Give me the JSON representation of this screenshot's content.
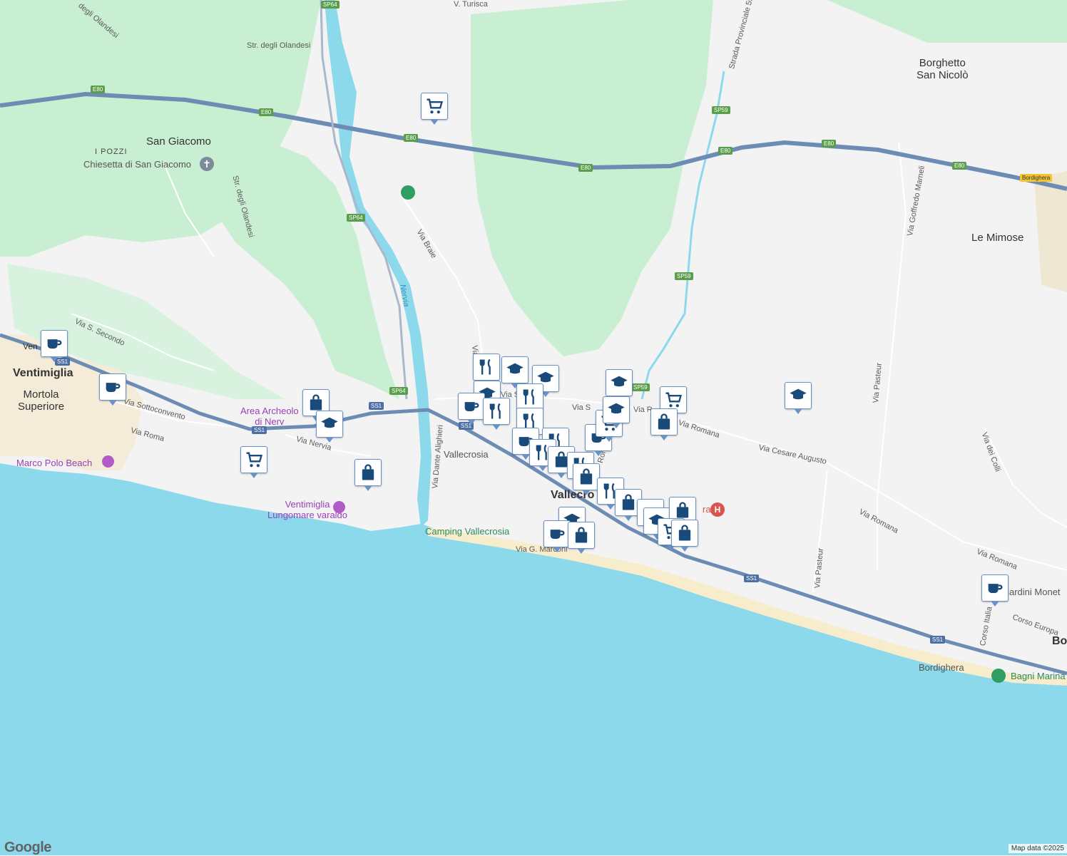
{
  "map": {
    "places": {
      "ventimiglia": "Ventimiglia",
      "mortola": "Mortola\nSuperiore",
      "san_giacomo": "San Giacomo",
      "i_pozzi": "I POZZI",
      "borghetto": "Borghetto\nSan Nicolò",
      "le_mimose": "Le Mimose",
      "vallecrosia": "Vallecro",
      "bordighera_cut": "Bor",
      "venti_cut": "Ven"
    },
    "pois": {
      "chiesetta": "Chiesetta di San Giacomo",
      "marco_polo": "Marco Polo Beach",
      "lungomare": "Ventimiglia\nLungomare varaldo",
      "area_archeo": "Area Archeolo\ndi Nerv",
      "camping": "Camping Vallecrosia",
      "bagni_marina": "Bagni Marina",
      "giardini": "Giardini Monet",
      "vallecrosia_station": "Vallecrosia",
      "bordighera_station": "Bordighera",
      "hospital_text": "ra"
    },
    "streets": {
      "str_olandesi_top": "Str. degli Olandesi",
      "str_olandesi_mid": "Str. degli Olandesi",
      "str_olandesi_left": "degli Olandesi",
      "v_turisca": "V. Turisca",
      "strada_prov": "Strada Provinciale 59",
      "via_braie": "Via Braie",
      "via_s_secondo": "Via S. Secondo",
      "via_sottoconvento": "Via Sottoconvento",
      "via_roma_left": "Via Roma",
      "via_nervia": "Via Nervia",
      "via_dante": "Via Dante Alighieri",
      "via_marconi": "Via G. Marconi",
      "via_romana_1": "Via Romana",
      "via_romana_2": "Via Romana",
      "via_romana_3": "Via Romana",
      "via_cesare": "Via Cesare Augusto",
      "via_pasteur_1": "Via Pasteur",
      "via_pasteur_2": "Via Pasteur",
      "via_goffredo": "Via Goffredo Mameli",
      "via_colli": "Via dei Colli",
      "corso_italia": "Corso Italia",
      "corso_europa": "Corso Europa",
      "via_s_short": "Via S",
      "via_r_short": "Via R",
      "via_a_short": "Via S.",
      "roma_short": "Roma",
      "via_short_vert": "Via"
    },
    "river": "Nervia",
    "shields": {
      "e80": "E80",
      "sp64": "SP64",
      "sp59": "SP59",
      "ss1": "SS1",
      "bordighera_exit": "Bordighera"
    },
    "icons": {
      "cafe": "coffee-cup-icon",
      "restaurant": "fork-knife-icon",
      "school": "graduation-cap-icon",
      "shop": "shopping-bag-icon",
      "grocery": "shopping-cart-icon",
      "train": "train-station-icon",
      "church": "church-cross-icon",
      "camera": "camera-icon",
      "hospital": "hospital-icon",
      "pin": "green-place-pin-icon"
    },
    "colors": {
      "sea": "#8cd9ec",
      "land": "#f3f3f4",
      "forest": "#c9efd3",
      "highway": "#6d8cb3",
      "pin_icon": "#1a4a7a",
      "beach": "#f7eccb"
    }
  },
  "footer": {
    "logo": "Google",
    "attribution": "Map data ©2025"
  }
}
